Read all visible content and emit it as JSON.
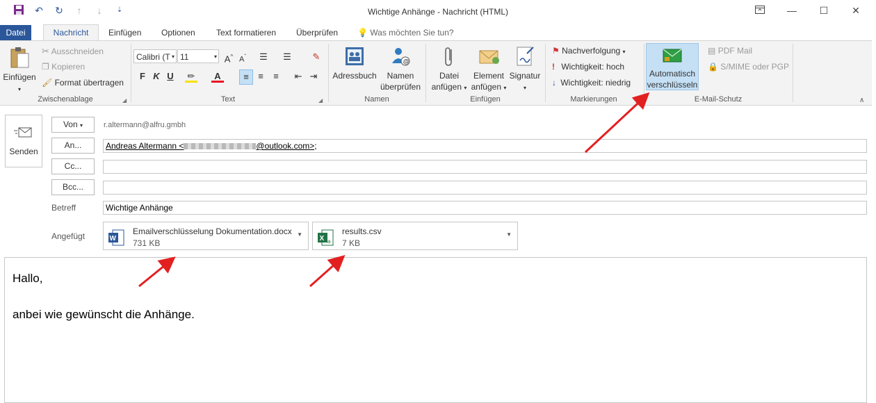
{
  "window": {
    "title": "Wichtige Anhänge  -  Nachricht (HTML)"
  },
  "tabs": [
    {
      "label": "Datei"
    },
    {
      "label": "Nachricht"
    },
    {
      "label": "Einfügen"
    },
    {
      "label": "Optionen"
    },
    {
      "label": "Text formatieren"
    },
    {
      "label": "Überprüfen"
    }
  ],
  "tell_me": {
    "placeholder": "Was möchten Sie tun?"
  },
  "ribbon": {
    "clipboard": {
      "paste": "Einfügen",
      "cut": "Ausschneiden",
      "copy": "Kopieren",
      "format_painter": "Format übertragen",
      "label": "Zwischenablage"
    },
    "text": {
      "font": "Calibri (T",
      "size": "11",
      "label": "Text"
    },
    "names": {
      "address_book": "Adressbuch",
      "check_names_1": "Namen",
      "check_names_2": "überprüfen",
      "label": "Namen"
    },
    "insert": {
      "attach_file_1": "Datei",
      "attach_file_2": "anfügen",
      "attach_item_1": "Element",
      "attach_item_2": "anfügen",
      "signature": "Signatur",
      "label": "Einfügen"
    },
    "tags": {
      "follow_up": "Nachverfolgung",
      "high": "Wichtigkeit: hoch",
      "low": "Wichtigkeit: niedrig",
      "label": "Markierungen"
    },
    "email_protection": {
      "auto_encrypt_1": "Automatisch",
      "auto_encrypt_2": "verschlüsseln",
      "pdf_mail": "PDF Mail",
      "smime": "S/MIME oder PGP",
      "label": "E-Mail-Schutz"
    }
  },
  "compose": {
    "send": "Senden",
    "from_button": "Von",
    "from_value": "r.altermann@alfru.gmbh",
    "to_button": "An...",
    "to_name": "Andreas Altermann <",
    "to_suffix": "@outlook.com>;",
    "cc_button": "Cc...",
    "bcc_button": "Bcc...",
    "subject_label": "Betreff",
    "subject_value": "Wichtige Anhänge",
    "attached_label": "Angefügt",
    "attachments": [
      {
        "name": "Emailverschlüsselung Dokumentation.docx",
        "size": "731 KB"
      },
      {
        "name": "results.csv",
        "size": "7 KB"
      }
    ]
  },
  "body": {
    "greeting": "Hallo,",
    "line1": "anbei wie gewünscht die Anhänge."
  },
  "colors": {
    "accent": "#2b579a",
    "ribbon": "#f3f3f3",
    "selected": "#c5e0f5",
    "arrow": "#e32020"
  }
}
